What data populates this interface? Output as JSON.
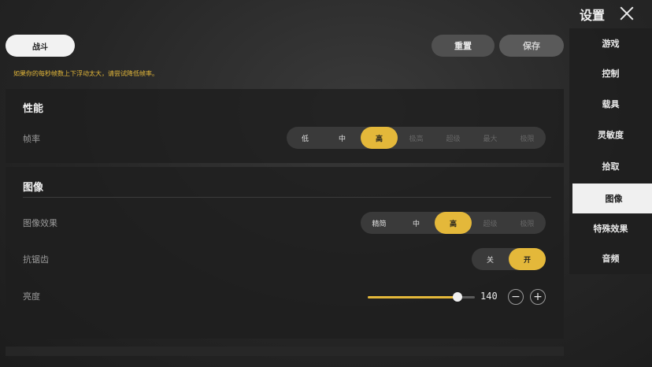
{
  "header": {
    "title": "设置"
  },
  "top_bar": {
    "category_tab": "战斗",
    "reset_label": "重置",
    "save_label": "保存",
    "warning": "如果你的每秒帧数上下浮动太大，请尝试降低帧率。"
  },
  "performance": {
    "title": "性能",
    "frame_rate": {
      "label": "帧率",
      "options": [
        "低",
        "中",
        "高",
        "极高",
        "超级",
        "最大",
        "极限"
      ],
      "selected": "高"
    }
  },
  "graphics": {
    "title": "图像",
    "quality": {
      "label": "图像效果",
      "options": [
        "精简",
        "中",
        "高",
        "超级",
        "极限"
      ],
      "selected": "高"
    },
    "anti_aliasing": {
      "label": "抗锯齿",
      "options": [
        "关",
        "开"
      ],
      "selected": "开"
    },
    "brightness": {
      "label": "亮度",
      "value": "140",
      "fill_fraction": 0.84,
      "minus": "−",
      "plus": "+"
    }
  },
  "sidebar": {
    "items": [
      {
        "label": "游戏"
      },
      {
        "label": "控制"
      },
      {
        "label": "载具"
      },
      {
        "label": "灵敏度"
      },
      {
        "label": "拾取"
      },
      {
        "label": "图像",
        "active": true
      },
      {
        "label": "特殊效果"
      },
      {
        "label": "音频"
      }
    ]
  },
  "colors": {
    "accent": "#e4b83a",
    "panel": "#1e1e1e"
  }
}
